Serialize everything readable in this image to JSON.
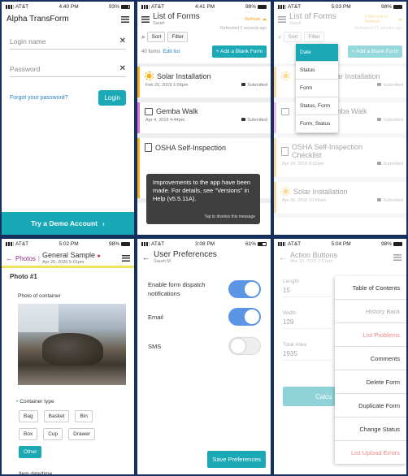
{
  "p1": {
    "carrier": "AT&T",
    "time": "4:40 PM",
    "battery": "93%",
    "battery_fill": 0.93,
    "title": "Alpha TransForm",
    "login_placeholder": "Login name",
    "password_placeholder": "Password",
    "forgot": "Forgot your password?",
    "login_btn": "Login",
    "demo": "Try a Demo Account"
  },
  "p2": {
    "carrier": "AT&T",
    "time": "4:41 PM",
    "battery": "98%",
    "battery_fill": 0.98,
    "title": "List of Forms",
    "user": "Sarah",
    "refresh": "Refresh",
    "refreshed": "Refreshed 0 seconds ago",
    "sort": "Sort",
    "filter": "Filter",
    "count": "40 forms",
    "edit": "Edit list",
    "add": "+ Add a Blank Form",
    "cards": [
      {
        "title": "Solar Installation",
        "date": "Feb 20, 2019 1:09pm",
        "status": "Submitted",
        "color": "#f5b318",
        "icon": "sun-icon"
      },
      {
        "title": "Gemba Walk",
        "date": "Apr 4, 2019 4:44pm",
        "status": "Submitted",
        "color": "#d873d8",
        "icon": "chat-icon",
        "sub": "-"
      },
      {
        "title": "OSHA Self-Inspection",
        "date": "",
        "status": "",
        "color": "#f5b318",
        "icon": "clipboard-icon"
      }
    ],
    "toast": "Improvements to the app have been made. For details, see \"Versions\" in Help (v5.5.11A).",
    "toast_dismiss": "Tap to dismiss this message"
  },
  "p3": {
    "carrier": "AT&T",
    "time": "5:03 PM",
    "battery": "98%",
    "battery_fill": 0.98,
    "title": "List of Forms",
    "user": "Sarah",
    "refresh": "1 Record to Refresh",
    "refreshed": "Refreshed 22 minutes ago",
    "sort": "Sort",
    "filter": "Filter",
    "add": "+ Add a Blank Form",
    "sort_options": [
      "Date",
      "Status",
      "Form",
      "Status, Form",
      "Form, Status"
    ],
    "cards": [
      {
        "title": "Solar Installation",
        "date": "",
        "status": "Submitted"
      },
      {
        "title": "Gemba Walk",
        "date": "",
        "status": "Submitted"
      },
      {
        "title": "OSHA Self-Inspection Checklist",
        "date": "Apr 24, 2019 8:52am",
        "status": "Submitted"
      },
      {
        "title": "Solar Installation",
        "date": "Apr 26, 2019 10:06am",
        "status": "Submitted"
      }
    ]
  },
  "p4": {
    "carrier": "AT&T",
    "time": "5:02 PM",
    "battery": "98%",
    "battery_fill": 0.98,
    "section": "Photos",
    "title": "General Sample",
    "date": "Apr 20, 2020 5:01pm",
    "heading": "Photo #1",
    "photo_label": "Photo of container",
    "ctype": "Container type",
    "options": [
      "Bag",
      "Basket",
      "Bin",
      "Box",
      "Cup",
      "Drawer",
      "Other"
    ],
    "item_dt": "Item date/time"
  },
  "p5": {
    "carrier": "AT&T",
    "time": "3:08 PM",
    "battery": "61%",
    "battery_fill": 0.61,
    "title": "User Preferences",
    "user": "Sarah M.",
    "pref1": "Enable form dispatch notifications",
    "pref2": "Email",
    "pref3": "SMS",
    "save": "Save Preferences"
  },
  "p6": {
    "carrier": "AT&T",
    "time": "5:04 PM",
    "battery": "98%",
    "battery_fill": 0.98,
    "title": "Action Buttons",
    "date": "Mar 10, 2020 2:51pm",
    "length_label": "Length",
    "length": "15",
    "width_label": "Width",
    "width": "129",
    "area_label": "Total Area",
    "area": "1935",
    "calc": "Calcu",
    "menu": [
      "Table of Contents",
      "History Back",
      "List Problems",
      "Comments",
      "Delete Form",
      "Duplicate Form",
      "Change Status",
      "List Upload Errors"
    ]
  }
}
